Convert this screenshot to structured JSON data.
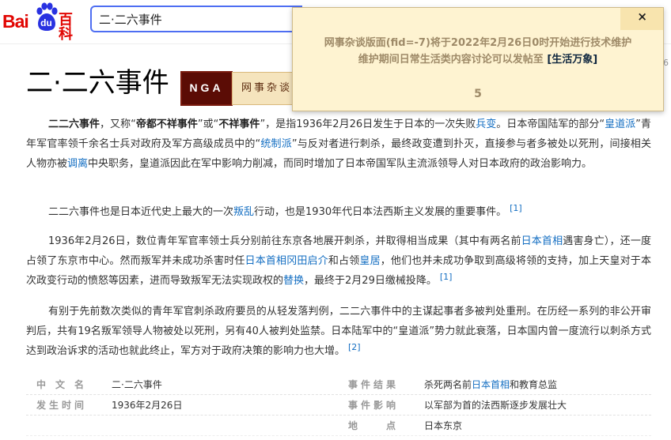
{
  "header": {
    "logo": {
      "bai": "Bai",
      "du": "du",
      "baike": "百科"
    },
    "search": {
      "value": "二·二六事件"
    }
  },
  "entry": {
    "title": "二·二六事件",
    "stray_digit": "6"
  },
  "badge": {
    "nga": "NGA",
    "tag": "网事杂谈"
  },
  "article": {
    "p1": {
      "t1": "二二六事件",
      "t2": "，又称“",
      "t3": "帝都不祥事件",
      "t4": "”或“",
      "t5": "不祥事件",
      "t6": "”，是指1936年2月26日发生于日本的一次失败",
      "l1": "兵变",
      "t7": "。日本帝国陆军的部分“",
      "l2": "皇道派",
      "t8": "”青年军官率领千余名士兵对政府及军方高级成员中的“",
      "l3": "统制派",
      "t9": "”与反对者进行刺杀，最终政变遭到扑灭，直接参与者多被处以死刑，间接相关人物亦被",
      "l4": "调离",
      "t10": "中央职务，皇道派因此在军中影响力削减，而同时增加了日本帝国军队主流派领导人对日本政府的政治影响力。"
    },
    "p2": {
      "t1": "二二六事件也是日本近代史上最大的一次",
      "l1": "叛乱",
      "t2": "行动，也是1930年代日本法西斯主义发展的重要事件。",
      "ref": "[1]"
    },
    "p3": {
      "t1": "1936年2月26日，数位青年军官率领士兵分别前往东京各地展开刺杀，并取得相当成果（其中有两名前",
      "l1": "日本首相",
      "t2": "遇害身亡），还一度占领了东京市中心。然而叛军并未成功杀害时任",
      "l2": "日本首相冈田启介",
      "t3": "和占领",
      "l3": "皇居",
      "t4": "，他们也并未成功争取到高级将领的支持，加上天皇对于本次政变行动的愤怒等因素，进而导致叛军无法实现政权的",
      "l4": "替换",
      "t5": "，最终于2月29日缴械投降。",
      "ref": "[1]"
    },
    "p4": {
      "t1": "有别于先前数次类似的青年军官刺杀政府要员的从轻发落判例，二二六事件中的主谋起事者多被判处重刑。在历经一系列的非公开审判后，共有19名叛军领导人物被处以死刑，另有40人被判处监禁。日本陆军中的“皇道派”势力就此衰落，日本国内曾一度流行以刺杀方式达到政治诉求的活动也就此终止，军方对于政府决策的影响力也大增。",
      "ref": "[2]"
    }
  },
  "infobox": {
    "rows": [
      {
        "k1": "中文名",
        "v1": "二·二六事件",
        "k2": "事件结果",
        "v2a": "杀死两名前",
        "v2link": "日本首相",
        "v2b": "和教育总监"
      },
      {
        "k1": "发生时间",
        "v1": "1936年2月26日",
        "k2": "事件影响",
        "v2": "以军部为首的法西斯逐步发展壮大"
      },
      {
        "k1": "",
        "v1": "",
        "k2": "地点",
        "v2": "日本东京"
      }
    ]
  },
  "notice": {
    "close": "×",
    "line1": "网事杂谈版面(fid=-7)将于2022年2月26日0时开始进行技术维护",
    "line2": "维护期间日常生活类内容讨论可以发帖至 ",
    "link": "[生活万象]",
    "countdown": "5"
  },
  "colors": {
    "brand_red": "#e10602",
    "baidu_blue": "#2932e1",
    "search_border": "#4e6ef2",
    "link_blue": "#136ec2",
    "notice_bg": "#fef3d1",
    "nga_brown": "#5b0c05"
  },
  "icons": {
    "logo_paw": "baidu-paw-icon",
    "close": "close-icon"
  }
}
